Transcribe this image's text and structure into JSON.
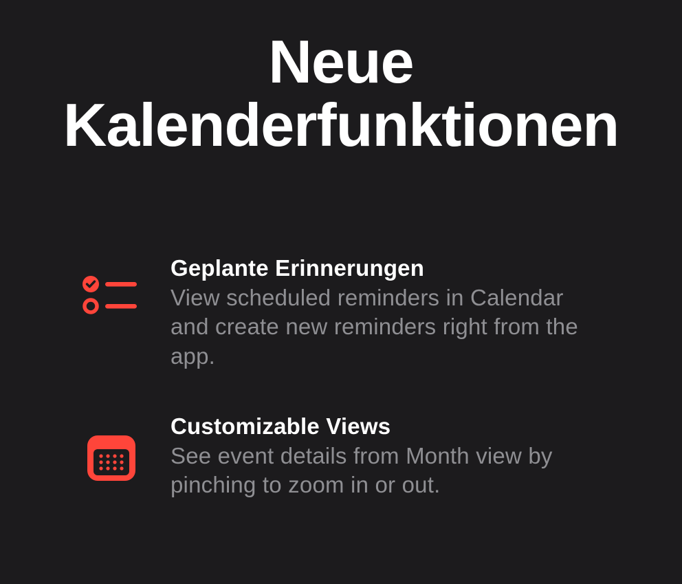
{
  "title": "Neue Kalenderfunktionen",
  "features": [
    {
      "title": "Geplante Erinnerungen",
      "desc": "View scheduled reminders in Calendar and create new reminders right from the app."
    },
    {
      "title": "Customizable Views",
      "desc": "See event details from Month view by pinching to zoom in or out."
    }
  ],
  "accent": "#ff453a"
}
